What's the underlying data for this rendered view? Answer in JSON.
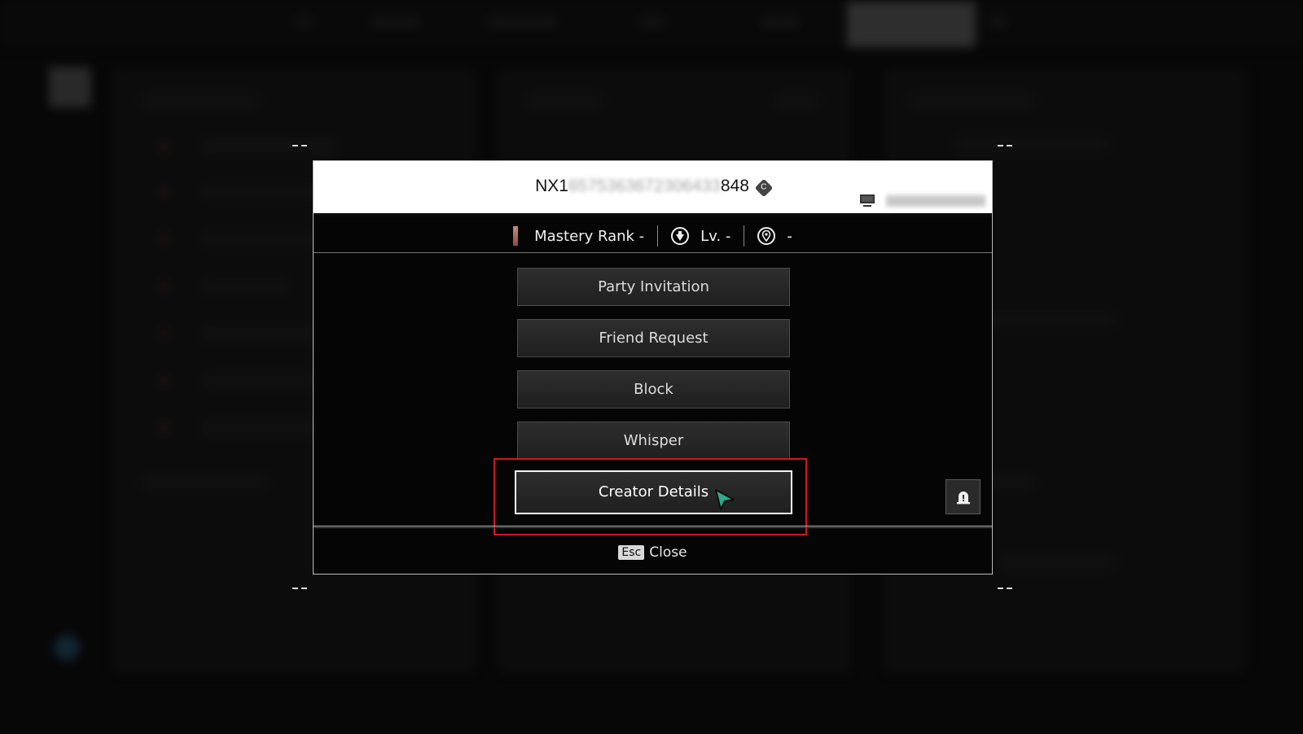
{
  "player": {
    "id_prefix": "NX1",
    "id_hidden": "6575363672306433",
    "id_suffix": "848",
    "badge": "C",
    "platform_id": "NX1575369672306"
  },
  "stats": {
    "mastery": "Mastery Rank -",
    "level": "Lv. -",
    "location": "-"
  },
  "actions": [
    {
      "label": "Party Invitation"
    },
    {
      "label": "Friend Request"
    },
    {
      "label": "Block"
    },
    {
      "label": "Whisper"
    },
    {
      "label": "Creator Details",
      "selected": true
    }
  ],
  "footer": {
    "key": "Esc",
    "label": "Close"
  },
  "colors": {
    "highlight": "#d0171d",
    "cursor": "#2fa88a"
  }
}
